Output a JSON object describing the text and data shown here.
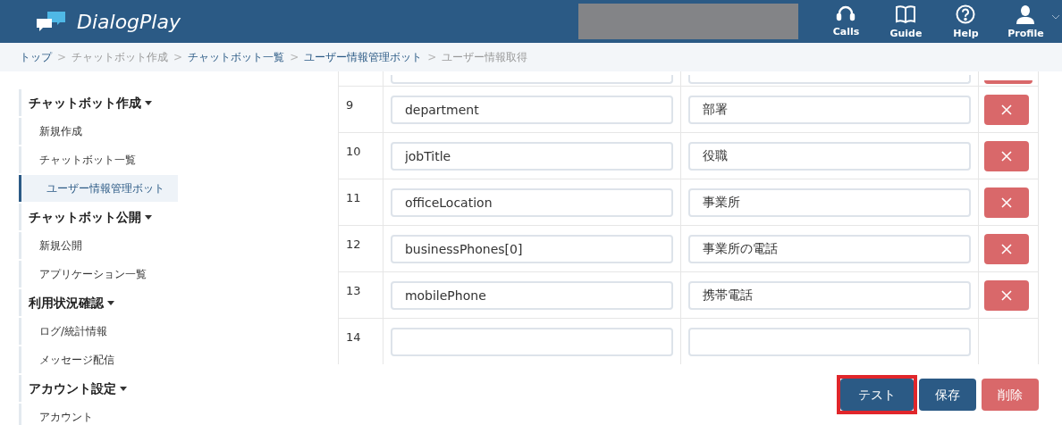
{
  "header": {
    "logo": "DialogPlay",
    "nav": [
      {
        "kind": "calls",
        "label": "Calls"
      },
      {
        "kind": "guide",
        "label": "Guide"
      },
      {
        "kind": "help",
        "label": "Help"
      },
      {
        "kind": "profile",
        "label": "Profile"
      }
    ]
  },
  "breadcrumb": {
    "separator": ">",
    "items": [
      {
        "label": "トップ",
        "link": true
      },
      {
        "label": "チャットボット作成",
        "link": false
      },
      {
        "label": "チャットボット一覧",
        "link": true
      },
      {
        "label": "ユーザー情報管理ボット",
        "link": true
      },
      {
        "label": "ユーザー情報取得",
        "link": false
      }
    ]
  },
  "sidebar": {
    "sections": [
      {
        "title": "チャットボット作成",
        "items": [
          {
            "label": "新規作成",
            "selected": false
          },
          {
            "label": "チャットボット一覧",
            "selected": false,
            "children": [
              {
                "label": "ユーザー情報管理ボット",
                "selected": true
              }
            ]
          }
        ]
      },
      {
        "title": "チャットボット公開",
        "items": [
          {
            "label": "新規公開",
            "selected": false
          },
          {
            "label": "アプリケーション一覧",
            "selected": false
          }
        ]
      },
      {
        "title": "利用状況確認",
        "items": [
          {
            "label": "ログ/統計情報",
            "selected": false
          },
          {
            "label": "メッセージ配信",
            "selected": false
          }
        ]
      },
      {
        "title": "アカウント設定",
        "items": [
          {
            "label": "アカウント",
            "selected": false
          }
        ]
      }
    ]
  },
  "table": {
    "rows": [
      {
        "number": "9",
        "key": "department",
        "value": "部署",
        "deletable": true
      },
      {
        "number": "10",
        "key": "jobTitle",
        "value": "役職",
        "deletable": true
      },
      {
        "number": "11",
        "key": "officeLocation",
        "value": "事業所",
        "deletable": true
      },
      {
        "number": "12",
        "key": "businessPhones[0]",
        "value": "事業所の電話",
        "deletable": true
      },
      {
        "number": "13",
        "key": "mobilePhone",
        "value": "携帯電話",
        "deletable": true
      },
      {
        "number": "14",
        "key": "",
        "value": "",
        "deletable": false
      }
    ]
  },
  "actions": [
    {
      "kind": "primary",
      "label": "テスト",
      "highlighted": true
    },
    {
      "kind": "primary",
      "label": "保存",
      "highlighted": false
    },
    {
      "kind": "danger",
      "label": "削除",
      "highlighted": false
    }
  ]
}
